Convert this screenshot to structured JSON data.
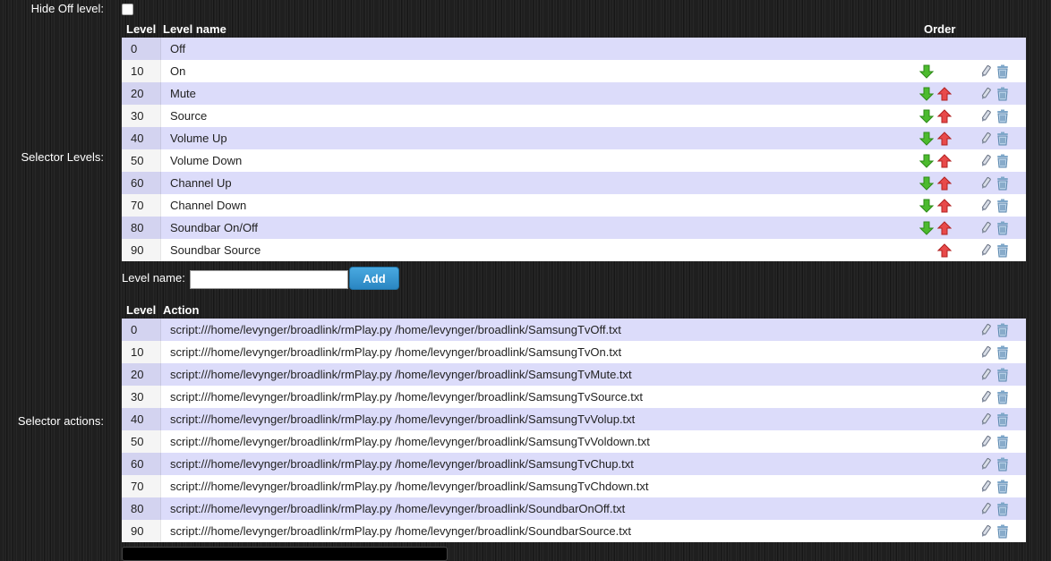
{
  "hide_off": {
    "label": "Hide Off level:",
    "checked": false
  },
  "levels": {
    "section_label": "Selector Levels:",
    "headers": {
      "level": "Level",
      "name": "Level name",
      "order": "Order"
    },
    "rows": [
      {
        "level": "0",
        "name": "Off"
      },
      {
        "level": "10",
        "name": "On"
      },
      {
        "level": "20",
        "name": "Mute"
      },
      {
        "level": "30",
        "name": "Source"
      },
      {
        "level": "40",
        "name": "Volume Up"
      },
      {
        "level": "50",
        "name": "Volume Down"
      },
      {
        "level": "60",
        "name": "Channel Up"
      },
      {
        "level": "70",
        "name": "Channel Down"
      },
      {
        "level": "80",
        "name": "Soundbar On/Off"
      },
      {
        "level": "90",
        "name": "Soundbar Source"
      }
    ],
    "new_level": {
      "label": "Level name:",
      "value": "",
      "button": "Add"
    }
  },
  "actions": {
    "section_label": "Selector actions:",
    "headers": {
      "level": "Level",
      "action": "Action"
    },
    "rows": [
      {
        "level": "0",
        "action": "script:///home/levynger/broadlink/rmPlay.py /home/levynger/broadlink/SamsungTvOff.txt"
      },
      {
        "level": "10",
        "action": "script:///home/levynger/broadlink/rmPlay.py /home/levynger/broadlink/SamsungTvOn.txt"
      },
      {
        "level": "20",
        "action": "script:///home/levynger/broadlink/rmPlay.py /home/levynger/broadlink/SamsungTvMute.txt"
      },
      {
        "level": "30",
        "action": "script:///home/levynger/broadlink/rmPlay.py /home/levynger/broadlink/SamsungTvSource.txt"
      },
      {
        "level": "40",
        "action": "script:///home/levynger/broadlink/rmPlay.py /home/levynger/broadlink/SamsungTvVolup.txt"
      },
      {
        "level": "50",
        "action": "script:///home/levynger/broadlink/rmPlay.py /home/levynger/broadlink/SamsungTvVoldown.txt"
      },
      {
        "level": "60",
        "action": "script:///home/levynger/broadlink/rmPlay.py /home/levynger/broadlink/SamsungTvChup.txt"
      },
      {
        "level": "70",
        "action": "script:///home/levynger/broadlink/rmPlay.py /home/levynger/broadlink/SamsungTvChdown.txt"
      },
      {
        "level": "80",
        "action": "script:///home/levynger/broadlink/rmPlay.py /home/levynger/broadlink/SoundbarOnOff.txt"
      },
      {
        "level": "90",
        "action": "script:///home/levynger/broadlink/rmPlay.py /home/levynger/broadlink/SoundbarSource.txt"
      }
    ]
  },
  "icons": {
    "move_down": "arrow-down-icon",
    "move_up": "arrow-up-icon",
    "edit": "pencil-icon",
    "delete": "trash-icon"
  },
  "colors": {
    "row_odd": "#dcdcfa",
    "row_even": "#ffffff",
    "arrow_down": "#4cbb2e",
    "arrow_up": "#e84a4a",
    "button": "#2a86c2"
  }
}
